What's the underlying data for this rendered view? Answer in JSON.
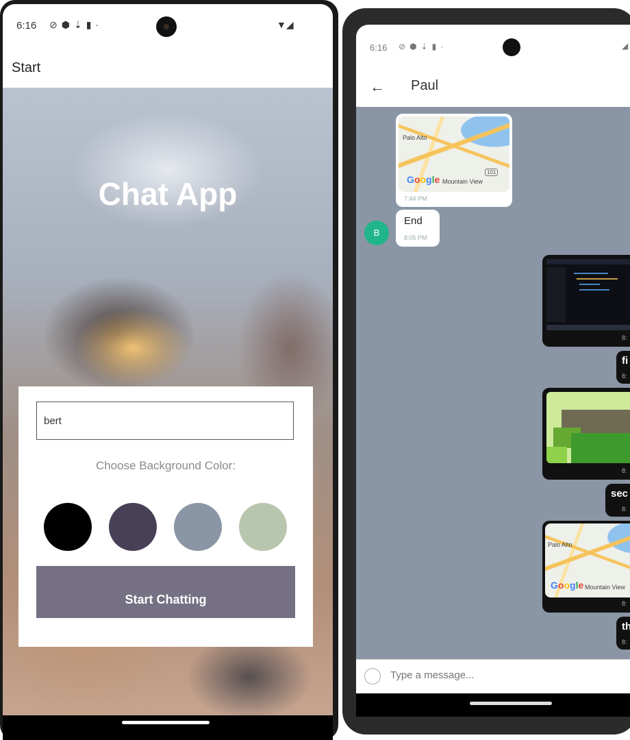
{
  "left_screen": {
    "status": {
      "time": "6:16",
      "icons": [
        "shield-off-icon",
        "shield-icon",
        "usb-icon",
        "sim-card-icon",
        "dot-icon"
      ],
      "right_icons": [
        "wifi-icon",
        "signal-icon"
      ]
    },
    "appbar": {
      "title": "Start"
    },
    "hero": {
      "title": "Chat App"
    },
    "form": {
      "name_value": "bert",
      "choose_label": "Choose Background Color:",
      "colors": [
        "#000000",
        "#474056",
        "#8a95a5",
        "#b9c6ae"
      ],
      "start_button": "Start Chatting",
      "button_color": "#757083"
    }
  },
  "right_screen": {
    "status": {
      "time": "6:16"
    },
    "appbar": {
      "back": "←",
      "title": "Paul"
    },
    "chat_background": "#8a95a5",
    "messages": {
      "map1": {
        "city": "Palo Alto",
        "brand": "Google",
        "place": "Mountain View",
        "highway": "101",
        "time": "7:44 PM"
      },
      "end": {
        "text": "End",
        "time": "8:05 PM",
        "avatar": "B"
      },
      "screenshot": {
        "time": "8:"
      },
      "first": {
        "text": "fi",
        "time": "8:"
      },
      "pixel": {
        "time": "8:"
      },
      "second": {
        "text": "sec",
        "time": "8:"
      },
      "map2": {
        "city": "Palo Alto",
        "brand": "Google",
        "place": "Mountain View",
        "time": "8:"
      },
      "third": {
        "text": "th",
        "time": "8:"
      }
    },
    "composer": {
      "placeholder": "Type a message..."
    }
  }
}
